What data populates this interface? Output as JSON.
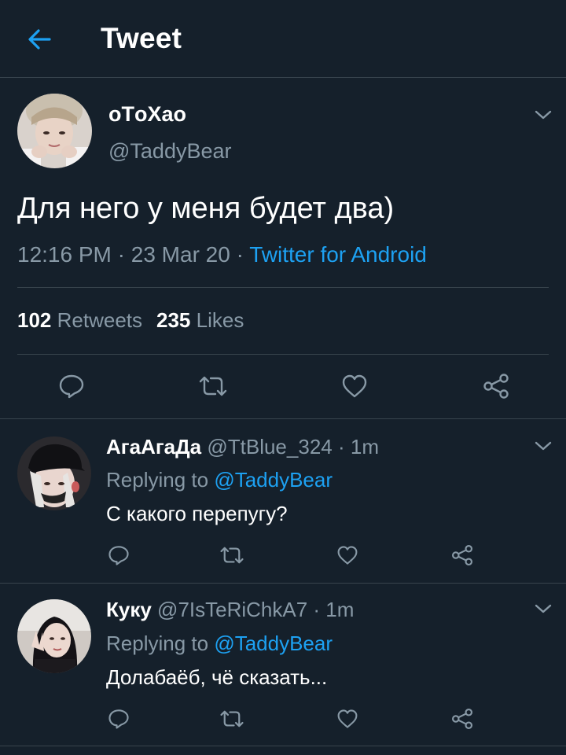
{
  "header": {
    "title": "Tweet",
    "back_icon": "arrow-left-icon",
    "accent_color": "#1da1f2"
  },
  "tweet": {
    "display_name": "ᴏTᴏXaᴏ",
    "handle": "@TaddyBear",
    "text": "Для него у меня будет два)",
    "time": "12:16 PM",
    "date": "23 Mar 20",
    "separator": " · ",
    "source": "Twitter for Android",
    "retweets_count": "102",
    "retweets_label": "Retweets",
    "likes_count": "235",
    "likes_label": "Likes"
  },
  "replies": [
    {
      "display_name": "АгаАгаДа",
      "handle": "@TtBlue_324",
      "time": "1m",
      "replying_to_label": "Replying to",
      "replying_to": "@TaddyBear",
      "text": "С какого перепугу?"
    },
    {
      "display_name": "Куку",
      "handle": "@7IsTeRiChkA7",
      "time": "1m",
      "replying_to_label": "Replying to",
      "replying_to": "@TaddyBear",
      "text": "Долабаёб, чё сказать..."
    }
  ],
  "colors": {
    "background": "#15202b",
    "divider": "#38444d",
    "secondary_text": "#8899a6",
    "link": "#1da1f2"
  }
}
